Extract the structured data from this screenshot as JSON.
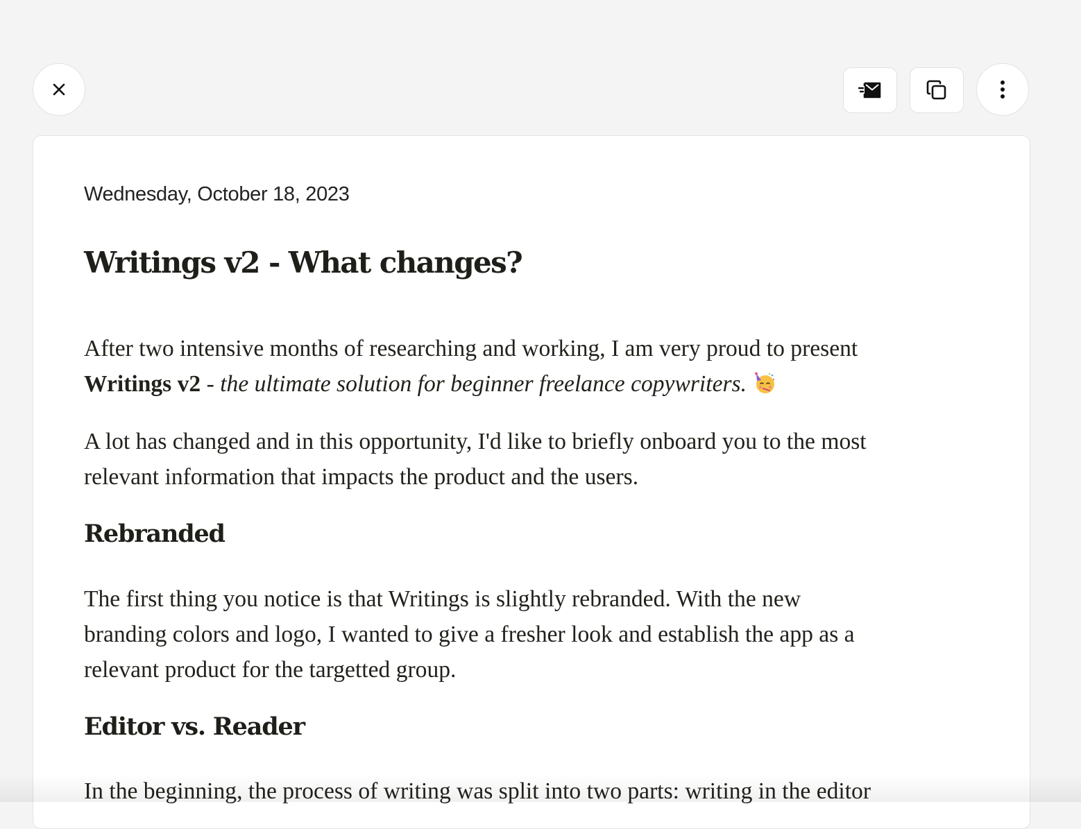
{
  "toolbar": {
    "close_icon": "close-icon",
    "publish_icon": "send-mail-icon",
    "copy_icon": "copy-icon",
    "more_icon": "more-vertical-icon"
  },
  "article": {
    "date": "Wednesday, October 18, 2023",
    "title": "Writings v2 - What changes?",
    "intro": {
      "line1": "After two intensive months of researching and working, I am very proud to present",
      "bold": "Writings v2",
      "dash": " - ",
      "italic": "the ultimate solution for beginner freelance copywriters",
      "end": ".",
      "emoji": "partying-face-emoji"
    },
    "paragraph2": {
      "line1": "A lot has changed and in this opportunity, I'd like to briefly onboard you to the most",
      "line2": "relevant information that impacts the product and the users."
    },
    "section1": {
      "heading": "Rebranded",
      "line1": "The first thing you notice is that Writings is slightly rebranded. With the new",
      "line2": "branding colors and logo, I wanted to give a fresher look and establish the app as a",
      "line3": "relevant product for the targetted group."
    },
    "section2": {
      "heading": "Editor vs. Reader",
      "line1": "In the beginning, the process of writing was split into two parts: writing in the editor"
    }
  }
}
